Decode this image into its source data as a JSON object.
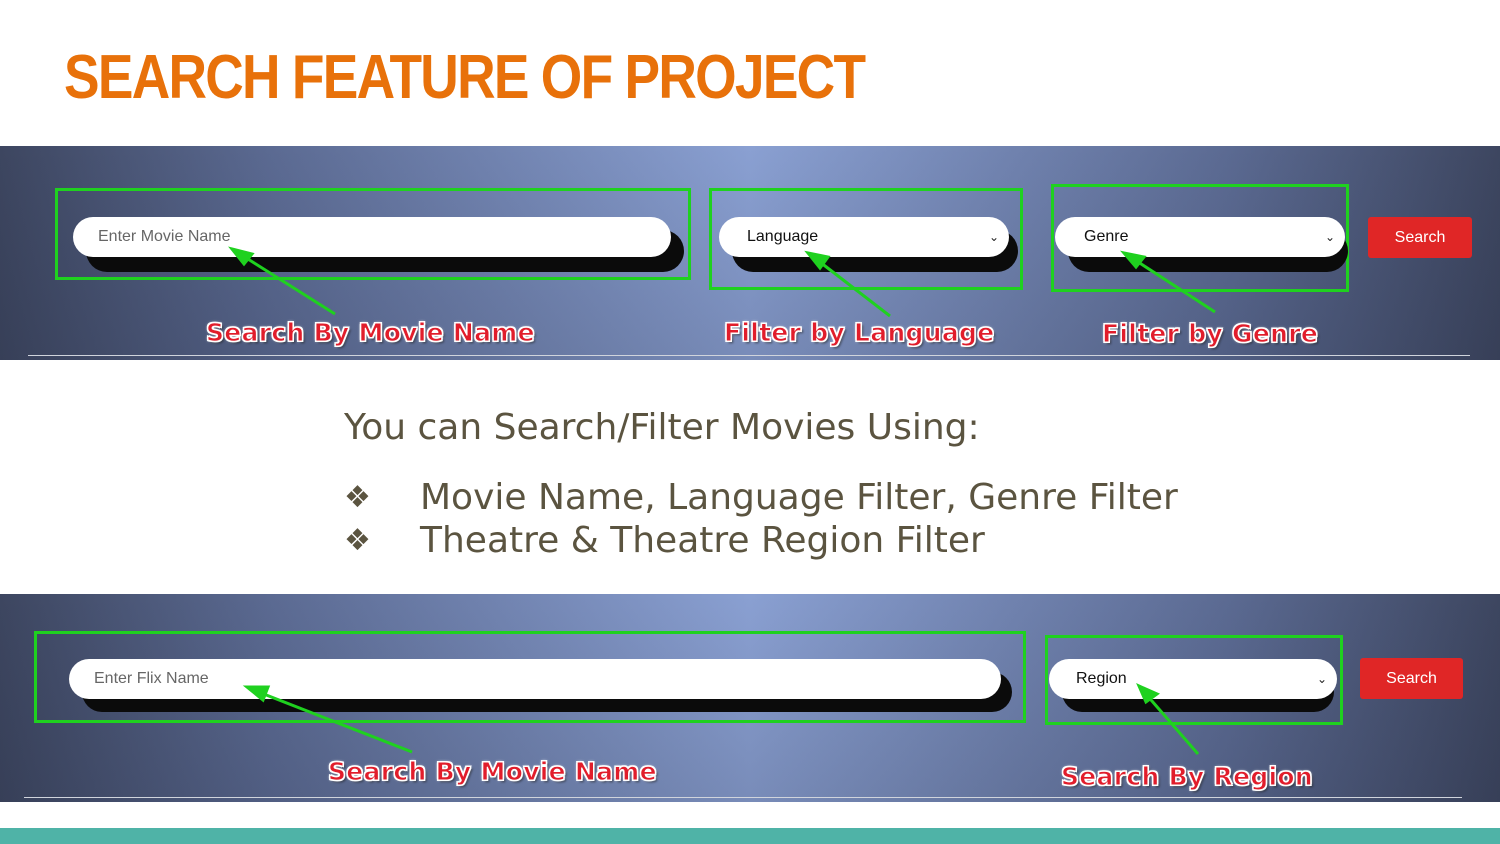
{
  "slide": {
    "title": "SEARCH FEATURE OF PROJECT"
  },
  "banner_top": {
    "search_placeholder": "Enter Movie Name",
    "language_value": "Language",
    "genre_value": "Genre",
    "search_button": "Search",
    "annotations": {
      "movie_name": "Search By Movie Name",
      "language": "Filter by Language",
      "genre": "Filter by Genre"
    }
  },
  "description": {
    "intro": "You can Search/Filter Movies Using:",
    "bullets": [
      "Movie Name, Language Filter, Genre Filter",
      "Theatre & Theatre Region Filter"
    ],
    "bullet_icon": "diamond-cluster-icon"
  },
  "banner_bottom": {
    "search_placeholder": "Enter Flix Name",
    "region_value": "Region",
    "search_button": "Search",
    "annotations": {
      "movie_name": "Search By Movie Name",
      "region": "Search By Region"
    }
  },
  "colors": {
    "title": "#e8710a",
    "highlight_box": "#1fd11f",
    "search_button": "#e02626",
    "annotation_text": "#e11d2b",
    "body_text": "#5b5440",
    "footer_bar": "#4fb3a7"
  }
}
